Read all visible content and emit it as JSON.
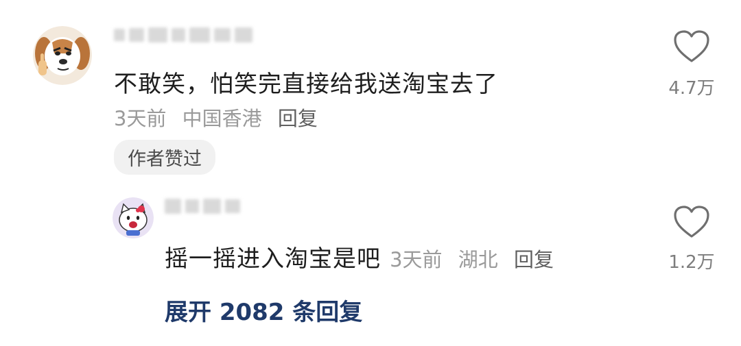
{
  "comment": {
    "avatar_icon": "dog-avatar-icon",
    "text": "不敢笑，怕笑完直接给我送淘宝去了",
    "time": "3天前",
    "location": "中国香港",
    "reply_label": "回复",
    "badge": "作者赞过",
    "like_icon": "heart-outline-icon",
    "like_count": "4.7万"
  },
  "reply": {
    "avatar_icon": "hello-kitty-avatar-icon",
    "text": "摇一摇进入淘宝是吧",
    "time": "3天前",
    "location": "湖北",
    "reply_label": "回复",
    "like_icon": "heart-outline-icon",
    "like_count": "1.2万"
  },
  "expand_label": "展开 2082 条回复"
}
